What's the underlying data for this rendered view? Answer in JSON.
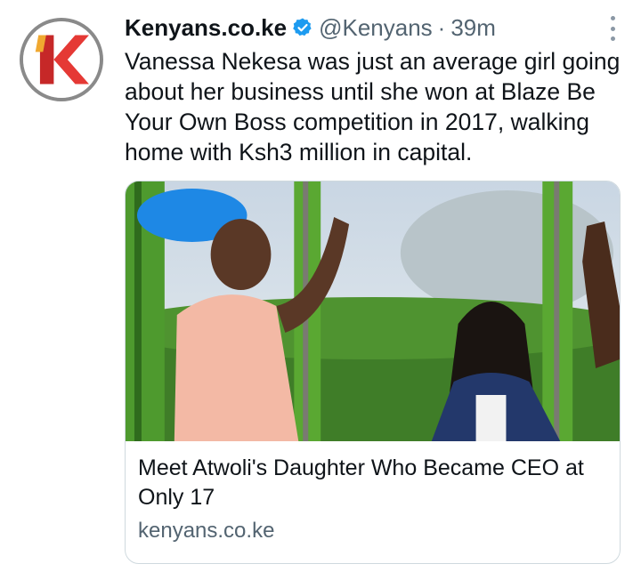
{
  "tweet": {
    "account_name": "Kenyans.co.ke",
    "handle": "@Kenyans",
    "separator": "·",
    "time": "39m",
    "text": "Vanessa Nekesa was just an average girl going about her business until she won at Blaze Be Your Own Boss competition in 2017, walking home with Ksh3 million in capital."
  },
  "link_card": {
    "title": "Meet Atwoli's Daughter Who Became CEO at Only 17",
    "domain": "kenyans.co.ke"
  },
  "colors": {
    "brand_red": "#d32f2f",
    "verified_blue": "#1d9bf0",
    "secondary_text": "#536471"
  }
}
